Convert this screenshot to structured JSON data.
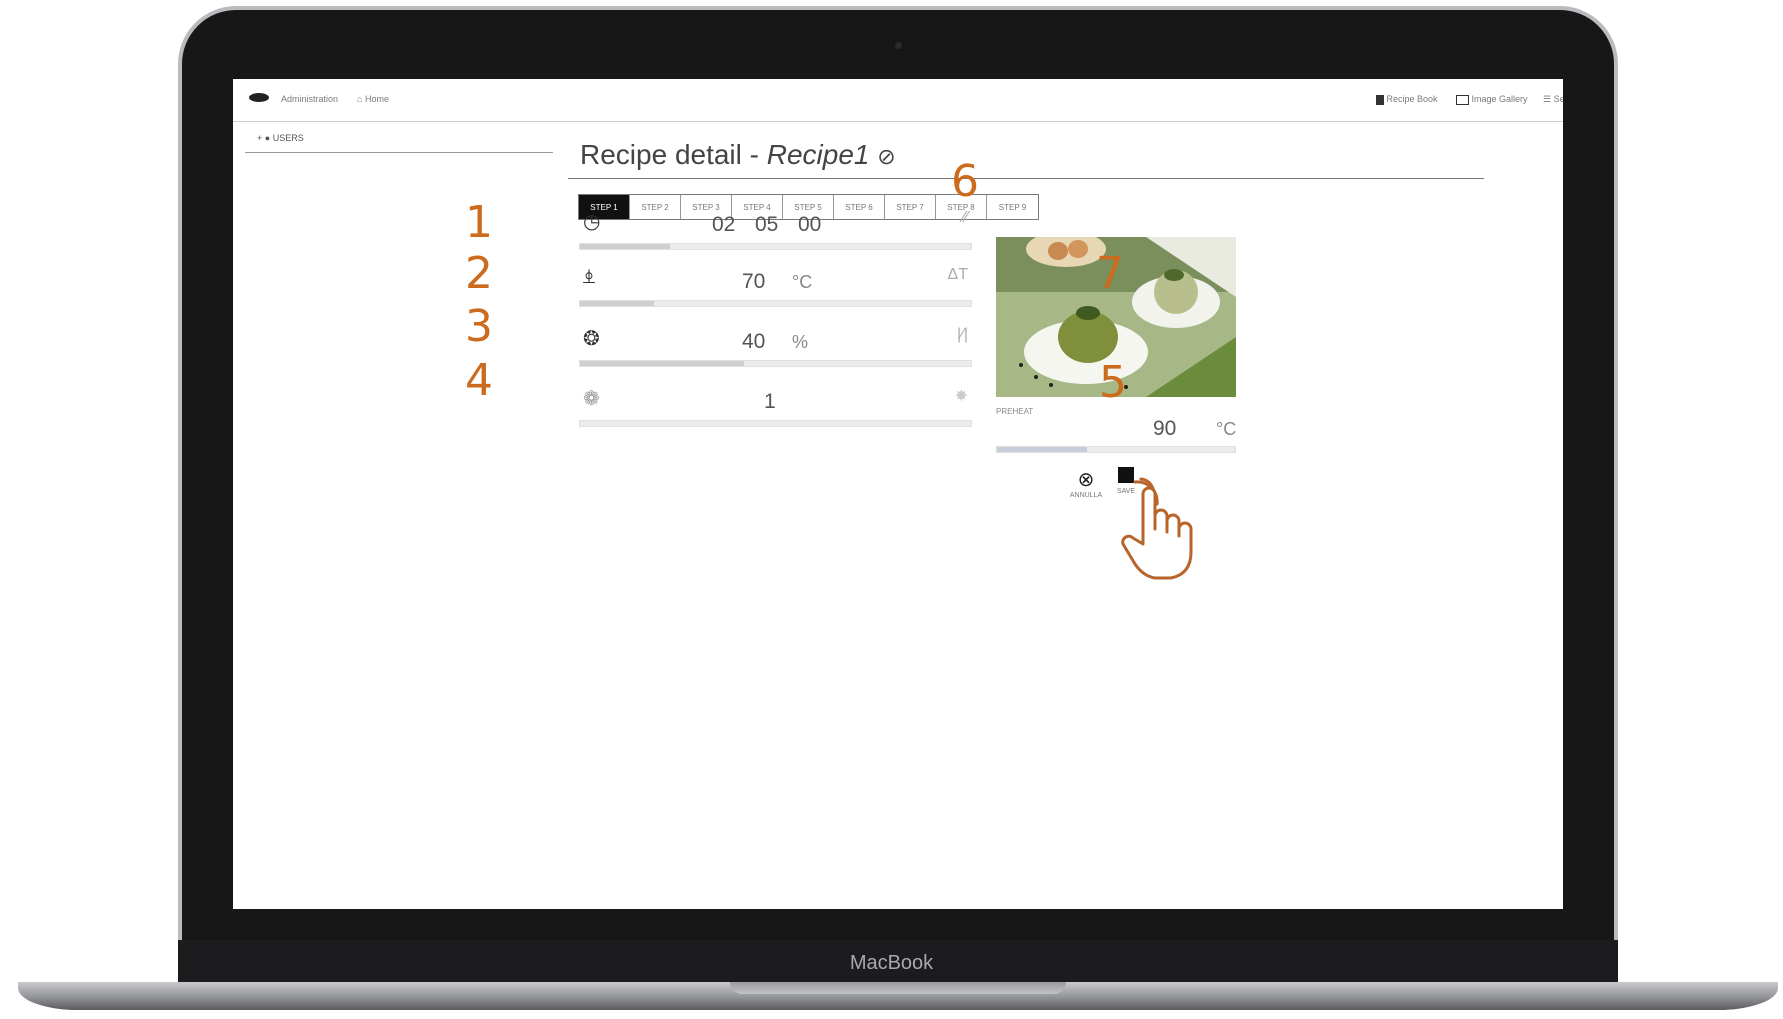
{
  "device": {
    "brand": "MacBook"
  },
  "topbar": {
    "admin_label": "Administration",
    "home_label": "Home",
    "recipe_book_label": "Recipe Book",
    "image_gallery_label": "Image Gallery",
    "settings_label": "Settings"
  },
  "sidebar": {
    "users_label": "USERS"
  },
  "page": {
    "title_prefix": "Recipe detail - ",
    "recipe_name": "Recipe1"
  },
  "steps": [
    "STEP 1",
    "STEP 2",
    "STEP 3",
    "STEP 4",
    "STEP 5",
    "STEP 6",
    "STEP 7",
    "STEP 8",
    "STEP 9"
  ],
  "params": {
    "time": {
      "hh": "02",
      "mm": "05",
      "ss": "00",
      "fill": 0.23
    },
    "temperature": {
      "value": "70",
      "unit": "°C",
      "right_label": "ΔT",
      "fill": 0.19
    },
    "humidity": {
      "value": "40",
      "unit": "%",
      "right_label": "|⁄|",
      "fill": 0.42
    },
    "fan": {
      "value": "1",
      "fill": 0.0
    }
  },
  "preheat": {
    "label": "PREHEAT",
    "value": "90",
    "unit": "°C",
    "fill": 0.38
  },
  "actions": {
    "cancel_label": "ANNULLA",
    "save_label": "SAVE"
  },
  "callouts": [
    "1",
    "2",
    "3",
    "4",
    "5",
    "6",
    "7"
  ],
  "colors": {
    "callout": "#cc6a1e",
    "active_step": "#111111"
  }
}
